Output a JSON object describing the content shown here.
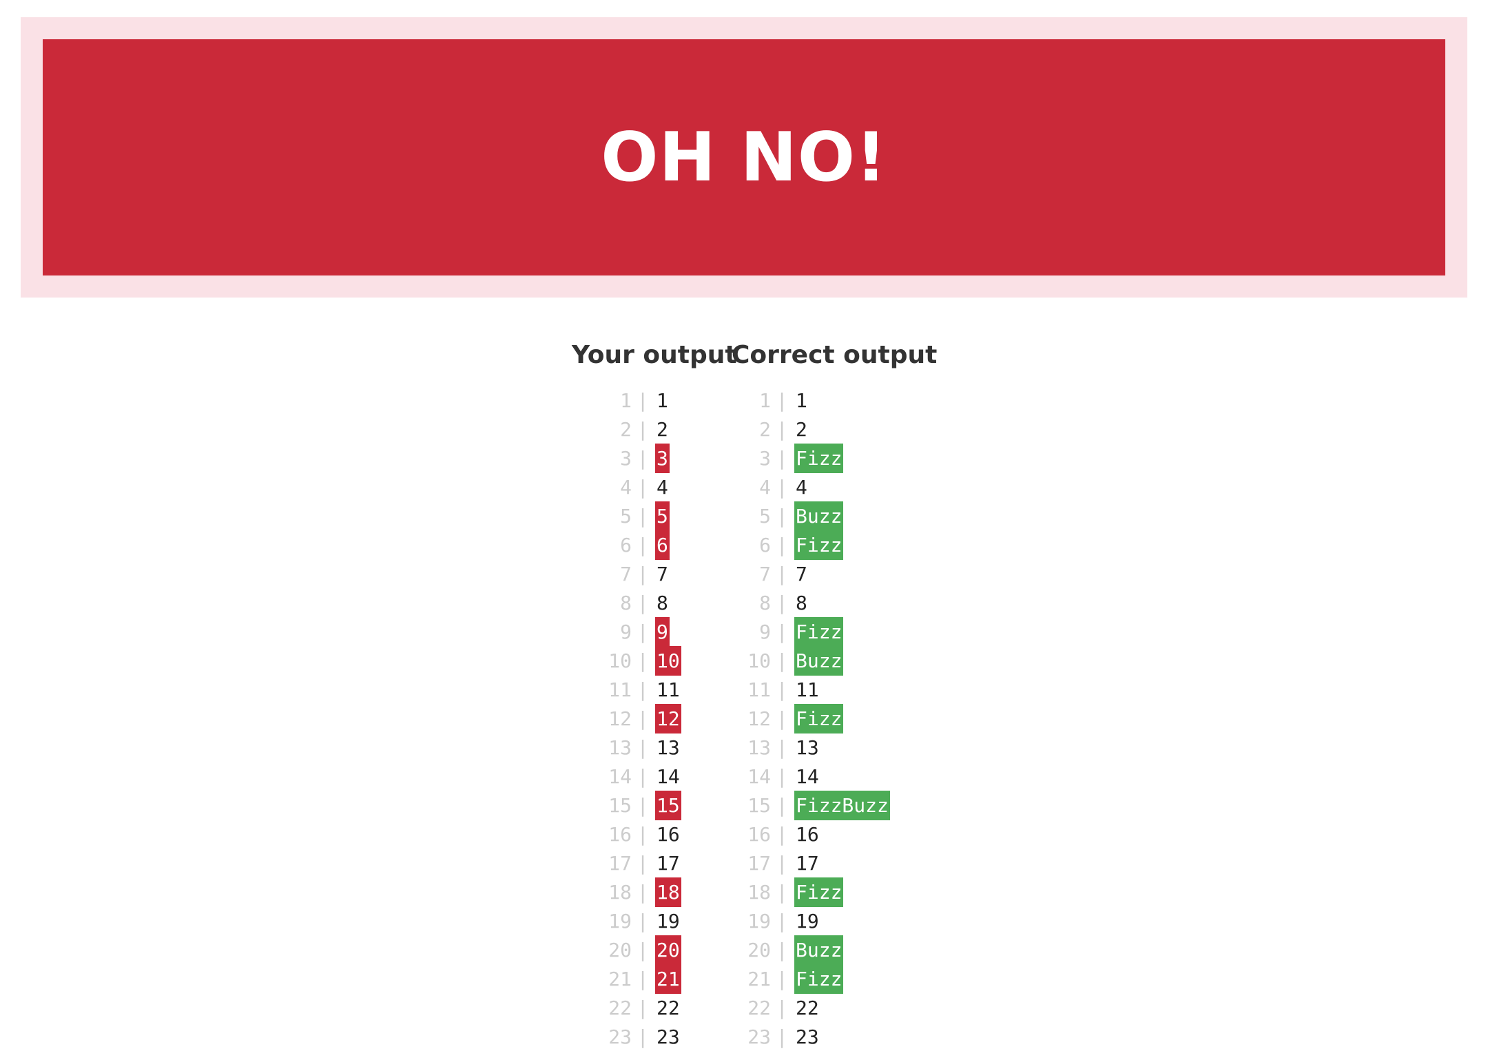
{
  "banner": {
    "title": "OH NO!"
  },
  "headings": {
    "your_output": "Your output",
    "correct_output": "Correct output"
  },
  "your_output": [
    {
      "line": "1",
      "value": "1",
      "wrong": false
    },
    {
      "line": "2",
      "value": "2",
      "wrong": false
    },
    {
      "line": "3",
      "value": "3",
      "wrong": true
    },
    {
      "line": "4",
      "value": "4",
      "wrong": false
    },
    {
      "line": "5",
      "value": "5",
      "wrong": true
    },
    {
      "line": "6",
      "value": "6",
      "wrong": true
    },
    {
      "line": "7",
      "value": "7",
      "wrong": false
    },
    {
      "line": "8",
      "value": "8",
      "wrong": false
    },
    {
      "line": "9",
      "value": "9",
      "wrong": true
    },
    {
      "line": "10",
      "value": "10",
      "wrong": true
    },
    {
      "line": "11",
      "value": "11",
      "wrong": false
    },
    {
      "line": "12",
      "value": "12",
      "wrong": true
    },
    {
      "line": "13",
      "value": "13",
      "wrong": false
    },
    {
      "line": "14",
      "value": "14",
      "wrong": false
    },
    {
      "line": "15",
      "value": "15",
      "wrong": true
    },
    {
      "line": "16",
      "value": "16",
      "wrong": false
    },
    {
      "line": "17",
      "value": "17",
      "wrong": false
    },
    {
      "line": "18",
      "value": "18",
      "wrong": true
    },
    {
      "line": "19",
      "value": "19",
      "wrong": false
    },
    {
      "line": "20",
      "value": "20",
      "wrong": true
    },
    {
      "line": "21",
      "value": "21",
      "wrong": true
    },
    {
      "line": "22",
      "value": "22",
      "wrong": false
    },
    {
      "line": "23",
      "value": "23",
      "wrong": false
    }
  ],
  "correct_output": [
    {
      "line": "1",
      "value": "1",
      "highlight": false
    },
    {
      "line": "2",
      "value": "2",
      "highlight": false
    },
    {
      "line": "3",
      "value": "Fizz",
      "highlight": true
    },
    {
      "line": "4",
      "value": "4",
      "highlight": false
    },
    {
      "line": "5",
      "value": "Buzz",
      "highlight": true
    },
    {
      "line": "6",
      "value": "Fizz",
      "highlight": true
    },
    {
      "line": "7",
      "value": "7",
      "highlight": false
    },
    {
      "line": "8",
      "value": "8",
      "highlight": false
    },
    {
      "line": "9",
      "value": "Fizz",
      "highlight": true
    },
    {
      "line": "10",
      "value": "Buzz",
      "highlight": true
    },
    {
      "line": "11",
      "value": "11",
      "highlight": false
    },
    {
      "line": "12",
      "value": "Fizz",
      "highlight": true
    },
    {
      "line": "13",
      "value": "13",
      "highlight": false
    },
    {
      "line": "14",
      "value": "14",
      "highlight": false
    },
    {
      "line": "15",
      "value": "FizzBuzz",
      "highlight": true
    },
    {
      "line": "16",
      "value": "16",
      "highlight": false
    },
    {
      "line": "17",
      "value": "17",
      "highlight": false
    },
    {
      "line": "18",
      "value": "Fizz",
      "highlight": true
    },
    {
      "line": "19",
      "value": "19",
      "highlight": false
    },
    {
      "line": "20",
      "value": "Buzz",
      "highlight": true
    },
    {
      "line": "21",
      "value": "Fizz",
      "highlight": true
    },
    {
      "line": "22",
      "value": "22",
      "highlight": false
    },
    {
      "line": "23",
      "value": "23",
      "highlight": false
    }
  ],
  "separator": "|",
  "colors": {
    "banner_outer": "#fae1e6",
    "banner_inner": "#ca2939",
    "wrong_highlight": "#ca2939",
    "correct_highlight": "#4cac56",
    "line_number": "#cccccc",
    "heading_text": "#333333"
  }
}
